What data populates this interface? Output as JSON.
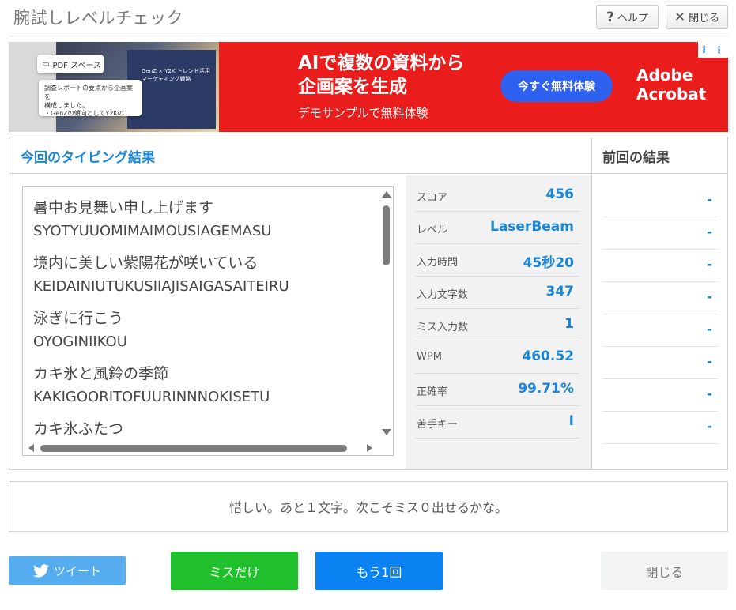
{
  "header": {
    "title": "腕試しレベルチェック",
    "help_label": "ヘルプ",
    "help_icon": "?",
    "close_label": "閉じる",
    "close_icon": "✕"
  },
  "ad": {
    "card1": "PDF スペース",
    "card2_line1": "調査レポートの要点から企画案を",
    "card2_line2": "構成しました。",
    "card2_line3": "・GenZの傾向としてY2Kの...",
    "doc_line1": "GenZ × Y2K トレンド活用",
    "doc_line2": "マーケティング戦略",
    "headline1": "AIで複数の資料から",
    "headline2": "企画案を生成",
    "sub": "デモサンプルで無料体験",
    "cta": "今すぐ無料体験",
    "brand1": "Adobe",
    "brand2": "Acrobat",
    "info_icon": "i",
    "more_icon": "⋮"
  },
  "results": {
    "current_title": "今回のタイピング結果",
    "previous_title": "前回の結果",
    "items": [
      {
        "jp": "暑中お見舞い申し上げます",
        "romaji": "SYOTYUUOMIMAIMOUSIAGEMASU"
      },
      {
        "jp": "境内に美しい紫陽花が咲いている",
        "romaji": "KEIDAINIUTUKUSIIAJISAIGASAITEIRU"
      },
      {
        "jp": "泳ぎに行こう",
        "romaji": "OYOGINIIKOU"
      },
      {
        "jp": "カキ氷と風鈴の季節",
        "romaji": "KAKIGOORITOFUURINNNOKISETU"
      },
      {
        "jp": "カキ氷ふたつ",
        "romaji": ""
      }
    ],
    "stats": [
      {
        "label": "スコア",
        "value": "456"
      },
      {
        "label": "レベル",
        "value": "LaserBeam"
      },
      {
        "label": "入力時間",
        "value": "45秒20"
      },
      {
        "label": "入力文字数",
        "value": "347"
      },
      {
        "label": "ミス入力数",
        "value": "1"
      },
      {
        "label": "WPM",
        "value": "460.52"
      },
      {
        "label": "正確率",
        "value": "99.71%"
      },
      {
        "label": "苦手キー",
        "value": "I"
      }
    ],
    "previous": [
      "-",
      "-",
      "-",
      "-",
      "-",
      "-",
      "-",
      "-"
    ]
  },
  "message": "惜しい。あと１文字。次こそミス０出せるかな。",
  "buttons": {
    "tweet": "ツイート",
    "miss_only": "ミスだけ",
    "again": "もう1回",
    "close": "閉じる"
  },
  "colors": {
    "accent_blue": "#1a86d8",
    "ad_red": "#eb1c1c",
    "tweet_blue": "#55acee",
    "miss_green": "#1fc02c",
    "again_blue": "#0a82f2"
  }
}
